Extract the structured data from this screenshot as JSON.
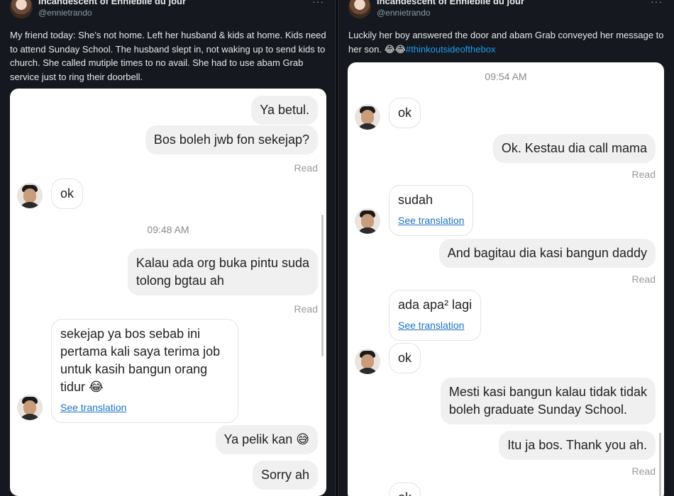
{
  "left_tweet": {
    "name": "Incandescent of Ennieblle du jour",
    "handle": "@ennietrando",
    "text": "My friend today: She’s not home. Left her husband & kids at home. Kids need to attend Sunday School. The husband slept in, not waking up to send kids to church. She called mutiple times to no avail. She had to use abam Grab service just to ring their doorbell.",
    "chat": {
      "m1": "Ya betul.",
      "m2": "Bos boleh jwb fon sekejap?",
      "read1": "Read",
      "m3": "ok",
      "time": "09:48 AM",
      "m4_l1": "Kalau ada org buka pintu suda",
      "m4_l2": "tolong bgtau ah",
      "read2": "Read",
      "m5_l1": "sekejap ya bos sebab ini",
      "m5_l2": "pertama kali saya terima job",
      "m5_l3": "untuk kasih bangun orang",
      "m5_l4": "tidur 😂",
      "m5_trans": "See translation",
      "m6": "Ya pelik kan 😅",
      "m7": "Sorry ah"
    }
  },
  "right_tweet": {
    "name": "Incandescent of Ennieblle du jour",
    "handle": "@ennietrando",
    "text_main": "Luckily her boy answered the door and abam Grab conveyed her message to her son. 😂😂",
    "hashtag": "#thinkoutsideofthebox",
    "chat": {
      "time": "09:54 AM",
      "m1": "ok",
      "m2": "Ok. Kestau dia call mama",
      "read1": "Read",
      "m3": "sudah",
      "m3_trans": "See translation",
      "m4": "And bagitau dia kasi bangun daddy",
      "read2": "Read",
      "m5": "ada apa² lagi",
      "m5_trans": "See translation",
      "m6": "ok",
      "m7_l1": "Mesti kasi bangun kalau tidak tidak",
      "m7_l2": "boleh graduate Sunday School.",
      "m8": "Itu ja bos. Thank you ah.",
      "read3": "Read",
      "m9": "ok"
    }
  },
  "icons": {
    "more": "more-icon",
    "avatar": "profile-avatar",
    "contact": "driver-avatar"
  }
}
